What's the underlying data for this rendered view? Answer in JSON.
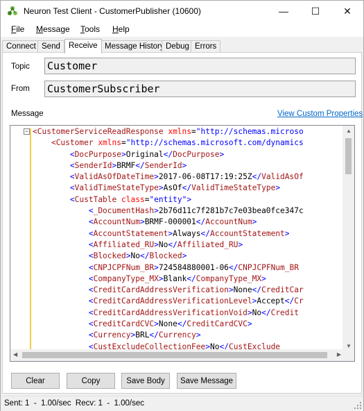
{
  "window": {
    "title": "Neuron Test Client - CustomerPublisher (10600)",
    "icon": "neuron-app-icon",
    "controls": {
      "minimize": "—",
      "maximize": "☐",
      "close": "✕"
    }
  },
  "menu": [
    {
      "label": "File",
      "accel": "F",
      "rest": "ile"
    },
    {
      "label": "Message",
      "accel": "M",
      "rest": "essage"
    },
    {
      "label": "Tools",
      "accel": "T",
      "rest": "ools"
    },
    {
      "label": "Help",
      "accel": "H",
      "rest": "elp"
    }
  ],
  "tabs": [
    "Connect",
    "Send",
    "Receive",
    "Message History",
    "Debug",
    "Errors"
  ],
  "active_tab": "Receive",
  "receive": {
    "topic_label": "Topic",
    "topic_value": "Customer",
    "from_label": "From",
    "from_value": "CustomerSubscriber",
    "message_label": "Message",
    "custom_props_link": "View Custom Properties"
  },
  "message_lines": [
    [
      [
        "t",
        "<CustomerServiceReadResponse "
      ],
      [
        "a",
        "xmlns"
      ],
      [
        "x",
        "="
      ],
      [
        "v",
        "\"http://schemas.microso"
      ]
    ],
    [
      [
        "x",
        "    "
      ],
      [
        "t",
        "<Customer "
      ],
      [
        "a",
        "xmlns"
      ],
      [
        "x",
        "="
      ],
      [
        "v",
        "\"http://schemas.microsoft.com/dynamics"
      ]
    ],
    [
      [
        "x",
        "        "
      ],
      [
        "b",
        "<"
      ],
      [
        "t",
        "DocPurpose"
      ],
      [
        "b",
        ">"
      ],
      [
        "x",
        "Original"
      ],
      [
        "b",
        "</"
      ],
      [
        "t",
        "DocPurpose"
      ],
      [
        "b",
        ">"
      ]
    ],
    [
      [
        "x",
        "        "
      ],
      [
        "b",
        "<"
      ],
      [
        "t",
        "SenderId"
      ],
      [
        "b",
        ">"
      ],
      [
        "x",
        "BRMF"
      ],
      [
        "b",
        "</"
      ],
      [
        "t",
        "SenderId"
      ],
      [
        "b",
        ">"
      ]
    ],
    [
      [
        "x",
        "        "
      ],
      [
        "b",
        "<"
      ],
      [
        "t",
        "ValidAsOfDateTime"
      ],
      [
        "b",
        ">"
      ],
      [
        "x",
        "2017-06-08T17:19:25Z"
      ],
      [
        "b",
        "</"
      ],
      [
        "t",
        "ValidAsOf"
      ]
    ],
    [
      [
        "x",
        "        "
      ],
      [
        "b",
        "<"
      ],
      [
        "t",
        "ValidTimeStateType"
      ],
      [
        "b",
        ">"
      ],
      [
        "x",
        "AsOf"
      ],
      [
        "b",
        "</"
      ],
      [
        "t",
        "ValidTimeStateType"
      ],
      [
        "b",
        ">"
      ]
    ],
    [
      [
        "x",
        "        "
      ],
      [
        "b",
        "<"
      ],
      [
        "t",
        "CustTable "
      ],
      [
        "a",
        "class"
      ],
      [
        "x",
        "="
      ],
      [
        "v",
        "\"entity\""
      ],
      [
        "b",
        ">"
      ]
    ],
    [
      [
        "x",
        "            "
      ],
      [
        "b",
        "<"
      ],
      [
        "t",
        "_DocumentHash"
      ],
      [
        "b",
        ">"
      ],
      [
        "x",
        "2b76d11c7f281b7c7e03bea0fce347c"
      ]
    ],
    [
      [
        "x",
        "            "
      ],
      [
        "b",
        "<"
      ],
      [
        "t",
        "AccountNum"
      ],
      [
        "b",
        ">"
      ],
      [
        "x",
        "BRMF-000001"
      ],
      [
        "b",
        "</"
      ],
      [
        "t",
        "AccountNum"
      ],
      [
        "b",
        ">"
      ]
    ],
    [
      [
        "x",
        "            "
      ],
      [
        "b",
        "<"
      ],
      [
        "t",
        "AccountStatement"
      ],
      [
        "b",
        ">"
      ],
      [
        "x",
        "Always"
      ],
      [
        "b",
        "</"
      ],
      [
        "t",
        "AccountStatement"
      ],
      [
        "b",
        ">"
      ]
    ],
    [
      [
        "x",
        "            "
      ],
      [
        "b",
        "<"
      ],
      [
        "t",
        "Affiliated_RU"
      ],
      [
        "b",
        ">"
      ],
      [
        "x",
        "No"
      ],
      [
        "b",
        "</"
      ],
      [
        "t",
        "Affiliated_RU"
      ],
      [
        "b",
        ">"
      ]
    ],
    [
      [
        "x",
        "            "
      ],
      [
        "b",
        "<"
      ],
      [
        "t",
        "Blocked"
      ],
      [
        "b",
        ">"
      ],
      [
        "x",
        "No"
      ],
      [
        "b",
        "</"
      ],
      [
        "t",
        "Blocked"
      ],
      [
        "b",
        ">"
      ]
    ],
    [
      [
        "x",
        "            "
      ],
      [
        "b",
        "<"
      ],
      [
        "t",
        "CNPJCPFNum_BR"
      ],
      [
        "b",
        ">"
      ],
      [
        "x",
        "724584880001-06"
      ],
      [
        "b",
        "</"
      ],
      [
        "t",
        "CNPJCPFNum_BR"
      ]
    ],
    [
      [
        "x",
        "            "
      ],
      [
        "b",
        "<"
      ],
      [
        "t",
        "CompanyType_MX"
      ],
      [
        "b",
        ">"
      ],
      [
        "x",
        "Blank"
      ],
      [
        "b",
        "</"
      ],
      [
        "t",
        "CompanyType_MX"
      ],
      [
        "b",
        ">"
      ]
    ],
    [
      [
        "x",
        "            "
      ],
      [
        "b",
        "<"
      ],
      [
        "t",
        "CreditCardAddressVerification"
      ],
      [
        "b",
        ">"
      ],
      [
        "x",
        "None"
      ],
      [
        "b",
        "</"
      ],
      [
        "t",
        "CreditCar"
      ]
    ],
    [
      [
        "x",
        "            "
      ],
      [
        "b",
        "<"
      ],
      [
        "t",
        "CreditCardAddressVerificationLevel"
      ],
      [
        "b",
        ">"
      ],
      [
        "x",
        "Accept"
      ],
      [
        "b",
        "</"
      ],
      [
        "t",
        "Cr"
      ]
    ],
    [
      [
        "x",
        "            "
      ],
      [
        "b",
        "<"
      ],
      [
        "t",
        "CreditCardAddressVerificationVoid"
      ],
      [
        "b",
        ">"
      ],
      [
        "x",
        "No"
      ],
      [
        "b",
        "</"
      ],
      [
        "t",
        "Credit"
      ]
    ],
    [
      [
        "x",
        "            "
      ],
      [
        "b",
        "<"
      ],
      [
        "t",
        "CreditCardCVC"
      ],
      [
        "b",
        ">"
      ],
      [
        "x",
        "None"
      ],
      [
        "b",
        "</"
      ],
      [
        "t",
        "CreditCardCVC"
      ],
      [
        "b",
        ">"
      ]
    ],
    [
      [
        "x",
        "            "
      ],
      [
        "b",
        "<"
      ],
      [
        "t",
        "Currency"
      ],
      [
        "b",
        ">"
      ],
      [
        "x",
        "BRL"
      ],
      [
        "b",
        "</"
      ],
      [
        "t",
        "Currency"
      ],
      [
        "b",
        ">"
      ]
    ],
    [
      [
        "x",
        "            "
      ],
      [
        "b",
        "<"
      ],
      [
        "t",
        "CustExcludeCollectionFee"
      ],
      [
        "b",
        ">"
      ],
      [
        "x",
        "No"
      ],
      [
        "b",
        "</"
      ],
      [
        "t",
        "CustExclude"
      ]
    ]
  ],
  "buttons": {
    "clear": "Clear",
    "copy": "Copy",
    "save_body": "Save Body",
    "save_message": "Save Message"
  },
  "status": "Sent: 1  -  1.00/sec  Recv: 1  -  1.00/sec",
  "colors": {
    "tag": "#a31515",
    "bracket": "#0000ff",
    "attr": "#ff0000",
    "link": "#0066cc",
    "fold_line": "#f2cc47"
  }
}
